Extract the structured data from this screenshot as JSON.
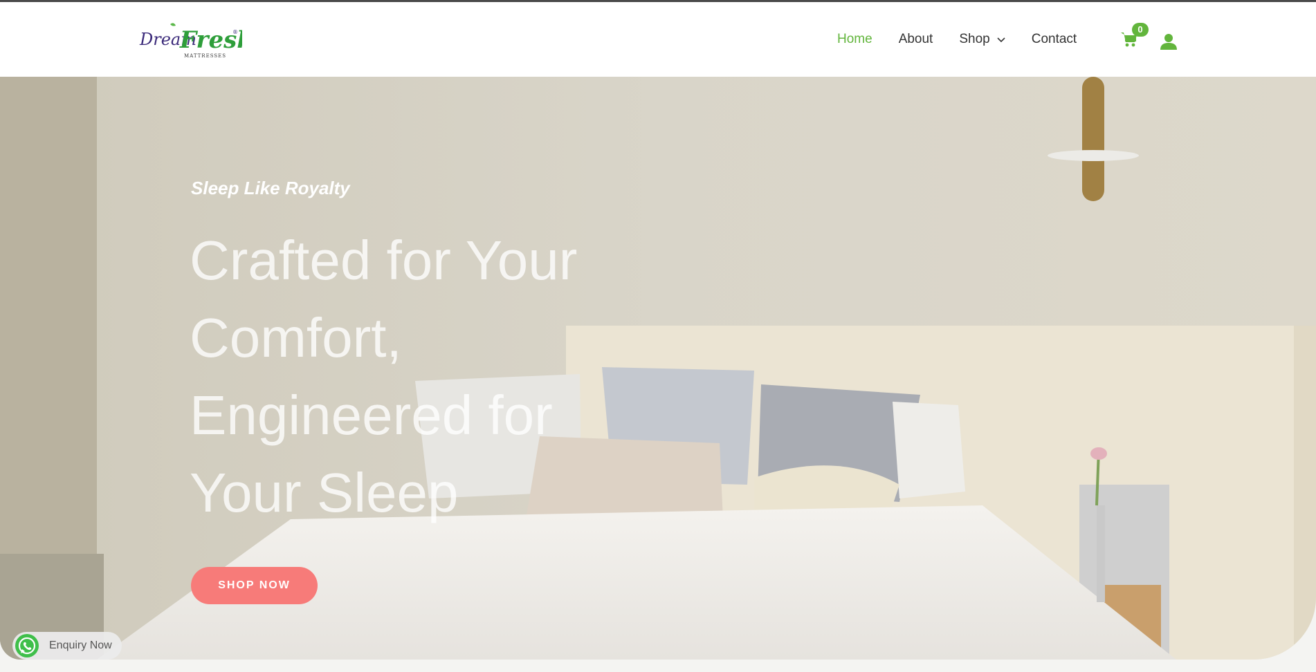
{
  "header": {
    "logo": {
      "word1": "Dream",
      "word2": "Fresh",
      "sub": "MATTRESSES",
      "mark": "®"
    },
    "nav": [
      {
        "label": "Home",
        "active": true
      },
      {
        "label": "About"
      },
      {
        "label": "Shop",
        "dropdown": true
      },
      {
        "label": "Contact"
      }
    ],
    "cart": {
      "icon": "cart-icon",
      "count": "0"
    },
    "account": {
      "icon": "user-icon"
    }
  },
  "hero": {
    "tagline": "Sleep Like Royalty",
    "headline": "Crafted for Your Comfort, Engineered for Your Sleep",
    "cta": "SHOP NOW"
  },
  "whatsapp": {
    "icon": "whatsapp-icon",
    "label": "Enquiry Now"
  },
  "colors": {
    "accent": "#62b53c",
    "cta": "#f77b79",
    "brand_purple": "#3b2a7a",
    "brand_green": "#2e9e3a"
  }
}
